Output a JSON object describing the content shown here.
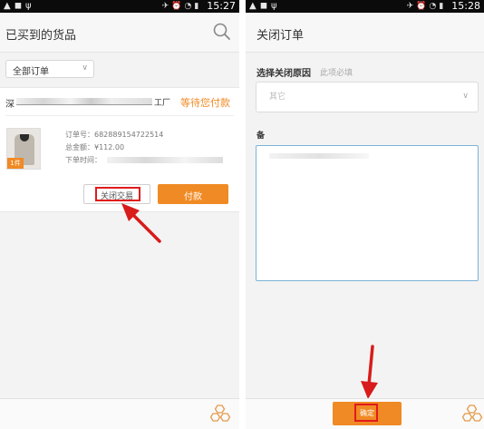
{
  "left_screen": {
    "status_bar": {
      "time": "15:27"
    },
    "page_title": "已买到的货品",
    "filter": {
      "selected": "全部订单"
    },
    "order": {
      "shop_prefix": "深",
      "shop_suffix": "工厂",
      "status": "等待您付款",
      "order_no_label": "订单号：",
      "order_no": "682889154722514",
      "total_label": "总金额：",
      "total": "¥112.00",
      "time_label": "下单时间：",
      "qty_badge": "1件",
      "close_trade_label": "关闭交易",
      "pay_label": "付款"
    }
  },
  "right_screen": {
    "status_bar": {
      "time": "15:28"
    },
    "page_title": "关闭订单",
    "reason_label": "选择关闭原因",
    "required_hint": "此项必填",
    "reason_value": "其它",
    "remark_label": "备",
    "confirm_label": "确定"
  },
  "colors": {
    "accent": "#f08a24",
    "highlight": "#e01b1b",
    "text_field_border": "#7ab3d8"
  },
  "icons": [
    "search-icon",
    "chevron-down-icon",
    "hexagon-cluster-icon",
    "red-arrow-icon"
  ]
}
